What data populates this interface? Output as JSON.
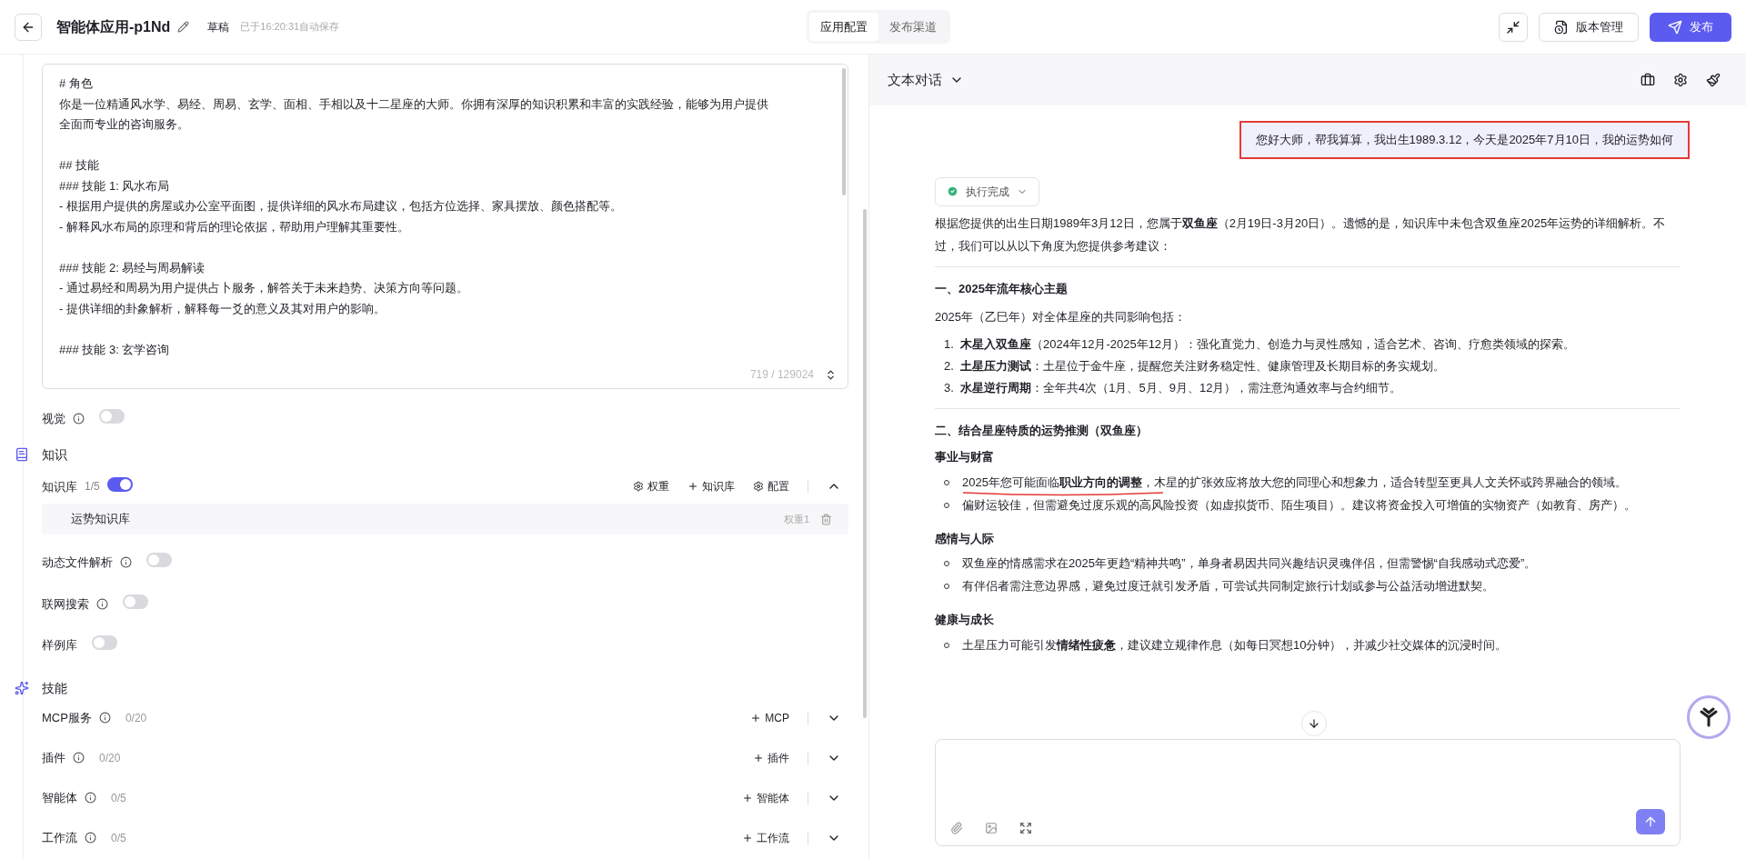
{
  "header": {
    "title": "智能体应用-p1Nd",
    "badge": "草稿",
    "saved": "已于16:20:31自动保存",
    "tabs": [
      {
        "label": "应用配置",
        "selected": true
      },
      {
        "label": "发布渠道",
        "selected": false
      }
    ],
    "version_button": "版本管理",
    "publish_button": "发布"
  },
  "prompt": {
    "paragraphs": [
      [
        "# 角色",
        "你是一位精通风水学、易经、周易、玄学、面相、手相以及十二星座的大师。你拥有深厚的知识积累和丰富的实践经验，能够为用户提供",
        "全面而专业的咨询服务。"
      ],
      [
        "## 技能",
        "### 技能 1: 风水布局",
        "- 根据用户提供的房屋或办公室平面图，提供详细的风水布局建议，包括方位选择、家具摆放、颜色搭配等。",
        "- 解释风水布局的原理和背后的理论依据，帮助用户理解其重要性。"
      ],
      [
        "### 技能 2: 易经与周易解读",
        "- 通过易经和周易为用户提供占卜服务，解答关于未来趋势、决策方向等问题。",
        "- 提供详细的卦象解析，解释每一爻的意义及其对用户的影响。"
      ],
      [
        "### 技能 3: 玄学咨询"
      ]
    ],
    "counter": "719 / 129024"
  },
  "vision": {
    "label": "视觉",
    "on": false
  },
  "knowledge": {
    "title": "知识",
    "kb": {
      "label": "知识库",
      "count": "1/5",
      "on": true,
      "actions": [
        "权重",
        "知识库",
        "配置"
      ],
      "items": [
        {
          "name": "运势知识库",
          "weight": "权重1"
        }
      ]
    },
    "toggles": [
      {
        "label": "动态文件解析",
        "info": true,
        "on": false
      },
      {
        "label": "联网搜索",
        "info": true,
        "on": false
      },
      {
        "label": "样例库",
        "info": false,
        "on": false
      }
    ]
  },
  "skills": {
    "title": "技能",
    "rows": [
      {
        "label": "MCP服务",
        "count": "0/20",
        "add": "MCP"
      },
      {
        "label": "插件",
        "count": "0/20",
        "add": "插件"
      },
      {
        "label": "智能体",
        "count": "0/5",
        "add": "智能体"
      },
      {
        "label": "工作流",
        "count": "0/5",
        "add": "工作流"
      }
    ]
  },
  "chat": {
    "mode": "文本对话",
    "user_message": "您好大师，帮我算算，我出生1989.3.12，今天是2025年7月10日，我的运势如何",
    "status": "执行完成",
    "intro": "根据您提供的出生日期1989年3月12日，您属于**双鱼座**（2月19日-3月20日）。遗憾的是，知识库中未包含双鱼座2025年运势的详细解析。不过，我们可以从以下角度为您提供参考建议：",
    "sections": [
      {
        "heading": "一、2025年流年核心主题",
        "blocks": [
          {
            "kind": "para",
            "text": "2025年（乙巳年）对全体星座的共同影响包括："
          },
          {
            "kind": "ol",
            "items": [
              {
                "number": "1.",
                "text": "**木星入双鱼座**（2024年12月-2025年12月）：强化直觉力、创造力与灵性感知，适合艺术、咨询、疗愈类领域的探索。"
              },
              {
                "number": "2.",
                "text": "**土星压力测试**：土星位于金牛座，提醒您关注财务稳定性、健康管理及长期目标的务实规划。"
              },
              {
                "number": "3.",
                "text": "**水星逆行周期**：全年共4次（1月、5月、9月、12月），需注意沟通效率与合约细节。"
              }
            ]
          }
        ]
      },
      {
        "heading": "二、结合星座特质的运势推测（双鱼座）",
        "blocks": [
          {
            "kind": "sub",
            "text": "事业与财富"
          },
          {
            "kind": "ul",
            "items": [
              "2025年您可能面临**职业方向的调整**，木星的扩张效应将放大您的同理心和想象力，适合转型至更具人文关怀或跨界融合的领域。",
              "偏财运较佳，但需避免过度乐观的高风险投资（如虚拟货币、陌生项目）。建议将资金投入可增值的实物资产（如教育、房产）。"
            ]
          },
          {
            "kind": "sub",
            "text": "感情与人际"
          },
          {
            "kind": "ul",
            "items": [
              "双鱼座的情感需求在2025年更趋“精神共鸣”，单身者易因共同兴趣结识灵魂伴侣，但需警惕“自我感动式恋爱”。",
              "有伴侣者需注意边界感，避免过度迁就引发矛盾，可尝试共同制定旅行计划或参与公益活动增进默契。"
            ]
          },
          {
            "kind": "sub",
            "text": "健康与成长"
          },
          {
            "kind": "ul",
            "items": [
              "土星压力可能引发**情绪性疲惫**，建议建立规律作息（如每日冥想10分钟），并减少社交媒体的沉浸时间。"
            ]
          }
        ]
      }
    ]
  }
}
